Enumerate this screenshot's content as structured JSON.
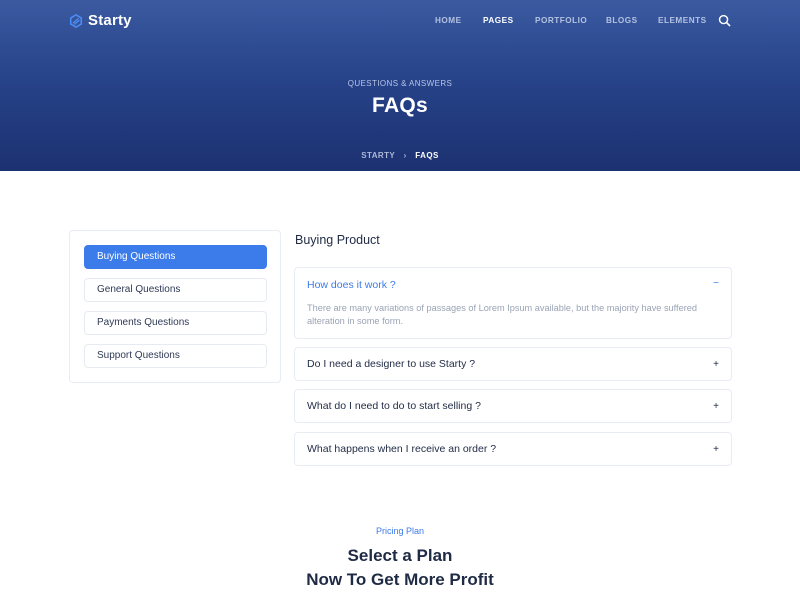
{
  "brand": {
    "name": "Starty",
    "accent": "#3b7bea",
    "hero_dark": "#1c3170",
    "icon": "logo-hex-icon"
  },
  "nav": {
    "items": [
      {
        "label": "HOME",
        "active": false
      },
      {
        "label": "PAGES",
        "active": true
      },
      {
        "label": "PORTFOLIO",
        "active": false
      },
      {
        "label": "BLOGS",
        "active": false
      },
      {
        "label": "ELEMENTS",
        "active": false
      }
    ],
    "search_icon": "search-icon"
  },
  "hero": {
    "kicker": "QUESTIONS & ANSWERS",
    "title": "FAQs",
    "breadcrumb": {
      "home": "STARTY",
      "separator": "›",
      "current": "FAQS"
    }
  },
  "sidebar": {
    "items": [
      {
        "label": "Buying Questions",
        "active": true
      },
      {
        "label": "General Questions",
        "active": false
      },
      {
        "label": "Payments Questions",
        "active": false
      },
      {
        "label": "Support Questions",
        "active": false
      }
    ]
  },
  "faq": {
    "title": "Buying Product",
    "items": [
      {
        "question": "How does it work ?",
        "toggle": "−",
        "open": true,
        "answer": "There are many variations of passages of Lorem Ipsum available, but the majority have suffered alteration in some form."
      },
      {
        "question": "Do I need a designer to use Starty ?",
        "toggle": "+",
        "open": false
      },
      {
        "question": "What do I need to do to start selling ?",
        "toggle": "+",
        "open": false
      },
      {
        "question": "What happens when I receive an order ?",
        "toggle": "+",
        "open": false
      }
    ]
  },
  "pricing": {
    "kicker": "Pricing Plan",
    "title_line1": "Select a Plan",
    "title_line2": "Now To Get More Profit"
  }
}
